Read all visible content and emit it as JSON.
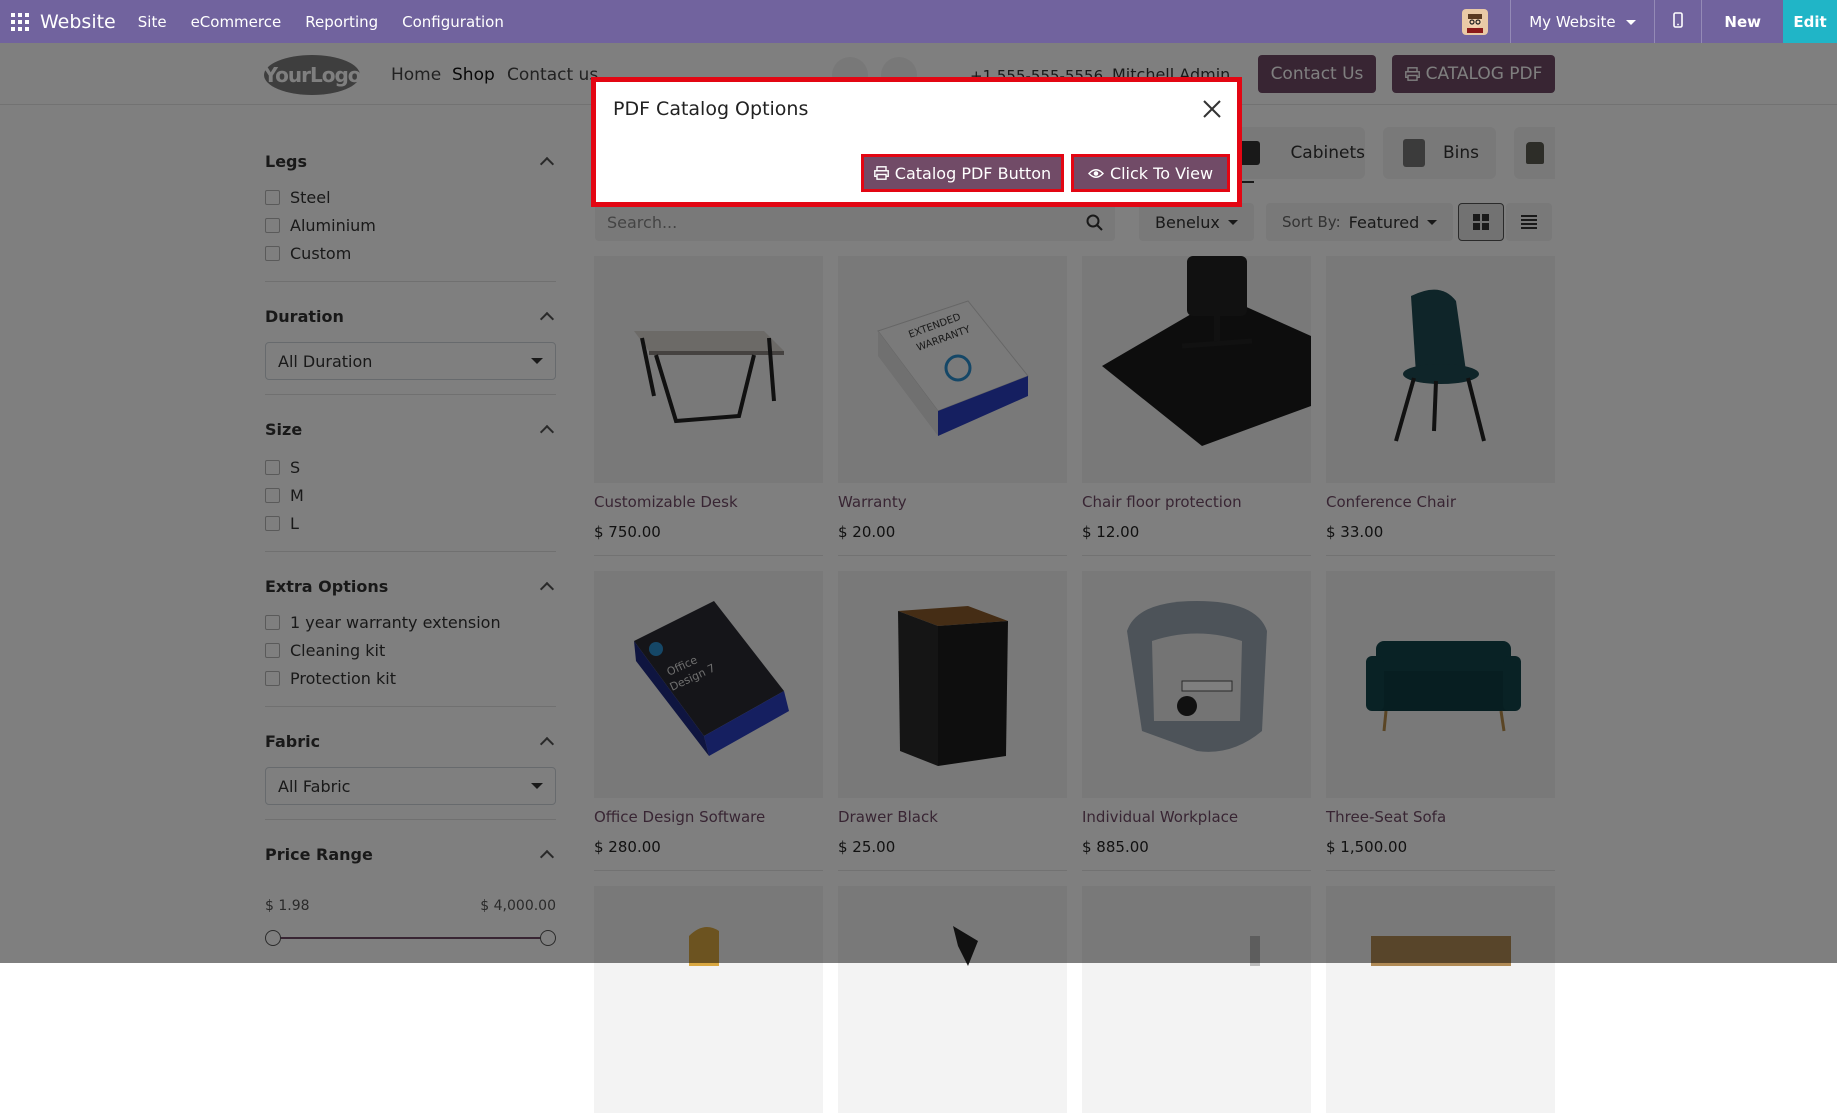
{
  "topbar": {
    "brand": "Website",
    "menus": [
      "Site",
      "eCommerce",
      "Reporting",
      "Configuration"
    ],
    "website_selector": "My Website",
    "new_label": "New",
    "edit_label": "Edit"
  },
  "header": {
    "logo_text": "YourLogo",
    "nav": [
      "Home",
      "Shop",
      "Contact us"
    ],
    "phone": "+1 555-555-5556",
    "user": "Mitchell Admin",
    "contact_button": "Contact Us",
    "catalog_button": "CATALOG PDF"
  },
  "filters": {
    "legs": {
      "title": "Legs",
      "options": [
        "Steel",
        "Aluminium",
        "Custom"
      ]
    },
    "duration": {
      "title": "Duration",
      "selected": "All Duration"
    },
    "size": {
      "title": "Size",
      "options": [
        "S",
        "M",
        "L"
      ]
    },
    "extra": {
      "title": "Extra Options",
      "options": [
        "1 year warranty extension",
        "Cleaning kit",
        "Protection kit"
      ]
    },
    "fabric": {
      "title": "Fabric",
      "selected": "All Fabric"
    },
    "price": {
      "title": "Price Range",
      "min": "$ 1.98",
      "max": "$ 4,000.00"
    }
  },
  "categories": [
    "Cabinets",
    "Bins"
  ],
  "toolbar": {
    "search_placeholder": "Search...",
    "pricelist": "Benelux",
    "sort_prefix": "Sort By:",
    "sort_value": "Featured"
  },
  "products": [
    {
      "name": "Customizable Desk",
      "price": "$ 750.00"
    },
    {
      "name": "Warranty",
      "price": "$ 20.00"
    },
    {
      "name": "Chair floor protection",
      "price": "$ 12.00"
    },
    {
      "name": "Conference Chair",
      "price": "$ 33.00"
    },
    {
      "name": "Office Design Software",
      "price": "$ 280.00"
    },
    {
      "name": "Drawer Black",
      "price": "$ 25.00"
    },
    {
      "name": "Individual Workplace",
      "price": "$ 885.00"
    },
    {
      "name": "Three-Seat Sofa",
      "price": "$ 1,500.00"
    }
  ],
  "modal": {
    "title": "PDF Catalog Options",
    "catalog_button": "Catalog PDF Button",
    "view_button": "Click To View"
  },
  "colors": {
    "odoo_purple": "#71639e",
    "brand": "#714b67",
    "edit_teal": "#20b5c7",
    "highlight": "#e30613"
  }
}
